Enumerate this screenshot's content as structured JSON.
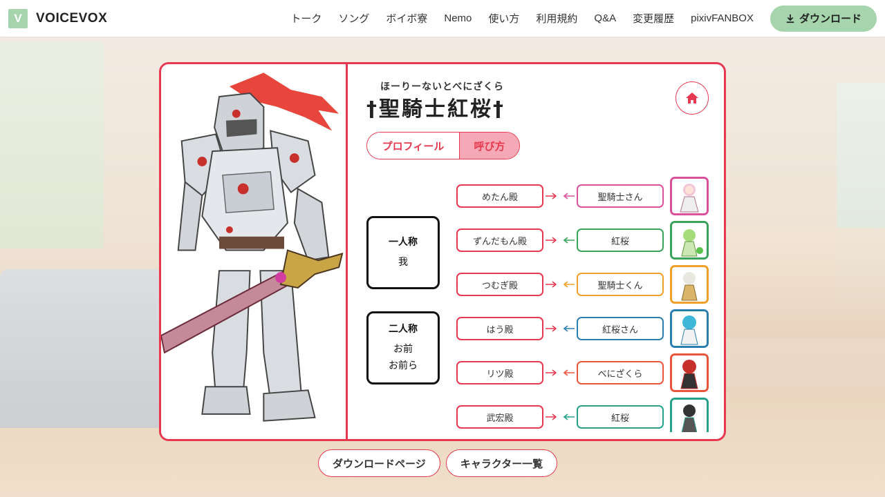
{
  "header": {
    "logo_letter": "V",
    "logo_text": "VOICEVOX",
    "nav": [
      "トーク",
      "ソング",
      "ボイボ寮",
      "Nemo",
      "使い方",
      "利用規約",
      "Q&A",
      "変更履歴",
      "pixivFANBOX"
    ],
    "download_label": "ダウンロード"
  },
  "character": {
    "ruby": "ほーりーないとべにざくら",
    "name": "†聖騎士紅桜†",
    "tabs": [
      "プロフィール",
      "呼び方"
    ],
    "active_tab": "呼び方"
  },
  "pronouns": [
    {
      "title": "一人称",
      "values": [
        "我"
      ]
    },
    {
      "title": "二人称",
      "values": [
        "お前",
        "お前ら"
      ]
    }
  ],
  "relations": [
    {
      "calls": "めたん殿",
      "called_by": "聖騎士さん",
      "color": "#d9509b"
    },
    {
      "calls": "ずんだもん殿",
      "called_by": "紅桜",
      "color": "#3aa35a"
    },
    {
      "calls": "つむぎ殿",
      "called_by": "聖騎士くん",
      "color": "#f0a028"
    },
    {
      "calls": "はう殿",
      "called_by": "紅桜さん",
      "color": "#2a7fb0"
    },
    {
      "calls": "リツ殿",
      "called_by": "べにざくら",
      "color": "#e8553a"
    },
    {
      "calls": "武宏殿",
      "called_by": "紅桜",
      "color": "#27a08a"
    }
  ],
  "bottom": {
    "download_page": "ダウンロードページ",
    "character_list": "キャラクター一覧"
  },
  "colors": {
    "accent": "#e6394f",
    "brand_green": "#a5d4ad"
  }
}
